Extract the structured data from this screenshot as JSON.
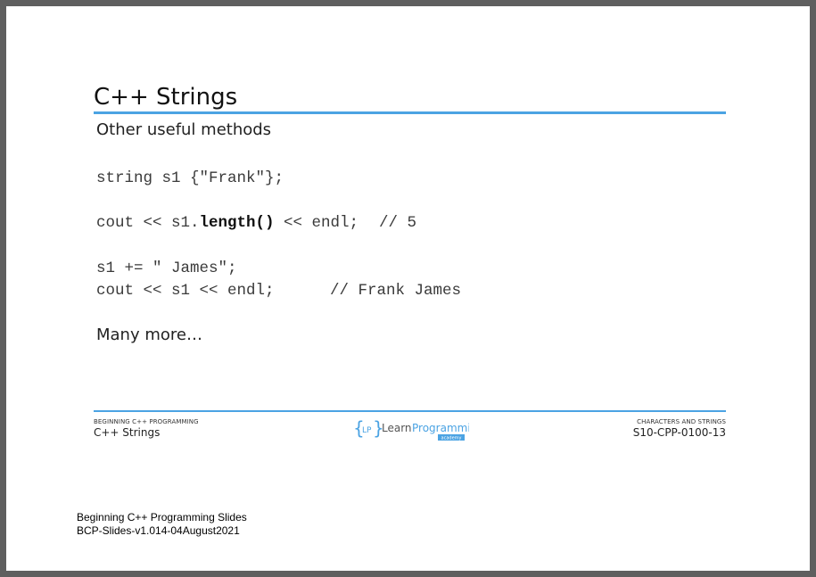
{
  "slide": {
    "title": "C++ Strings",
    "subtitle": "Other useful methods",
    "code": {
      "line1": "string s1 {\"Frank\"};",
      "line2_pre": "cout << s1.",
      "line2_bold": "length()",
      "line2_post": " << endl;",
      "line2_comment": "// 5",
      "line3": "s1 += \" James\";",
      "line4": "cout << s1 << endl;",
      "line4_comment": "// Frank James"
    },
    "more": "Many more…"
  },
  "footer": {
    "left_small": "BEGINNING C++ PROGRAMMING",
    "left_main": "C++ Strings",
    "right_small": "CHARACTERS AND STRINGS",
    "right_main": "S10-CPP-0100-13",
    "logo": {
      "brace_text": "LP",
      "name_part1": "Learn",
      "name_part2": "Programming",
      "tag": "academy"
    }
  },
  "document": {
    "line1": "Beginning C++ Programming Slides",
    "line2": "BCP-Slides-v1.014-04August2021"
  },
  "colors": {
    "accent": "#4ba3e3",
    "background": "#5f5f5f",
    "page": "#ffffff"
  }
}
